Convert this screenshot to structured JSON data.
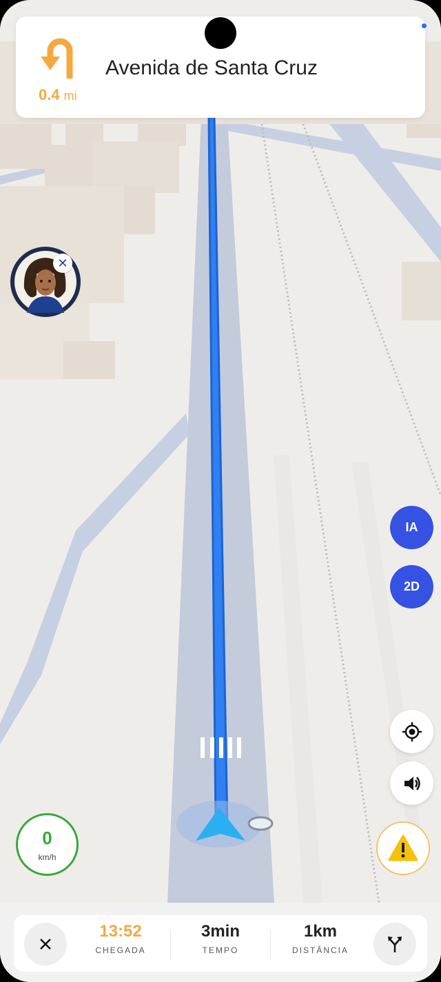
{
  "navigation": {
    "distance_value": "0.4",
    "distance_unit": "mi",
    "street_name": "Avenida de Santa Cruz",
    "turn_icon": "u-turn-left-icon"
  },
  "map_controls": {
    "ai_label": "IA",
    "view_mode_label": "2D",
    "recenter_icon": "crosshair-icon",
    "sound_icon": "speaker-icon",
    "alert_icon": "warning-icon"
  },
  "speedometer": {
    "speed": "0",
    "unit": "km/h"
  },
  "trip_summary": {
    "arrival_time": "13:52",
    "arrival_label": "CHEGADA",
    "duration": "3min",
    "duration_label": "TEMPO",
    "distance": "1km",
    "distance_label": "DISTÂNCIA"
  },
  "colors": {
    "route_blue": "#2f80f2",
    "accent_orange": "#f4a93f",
    "button_blue": "#3552e2",
    "speed_green": "#39a83a"
  }
}
